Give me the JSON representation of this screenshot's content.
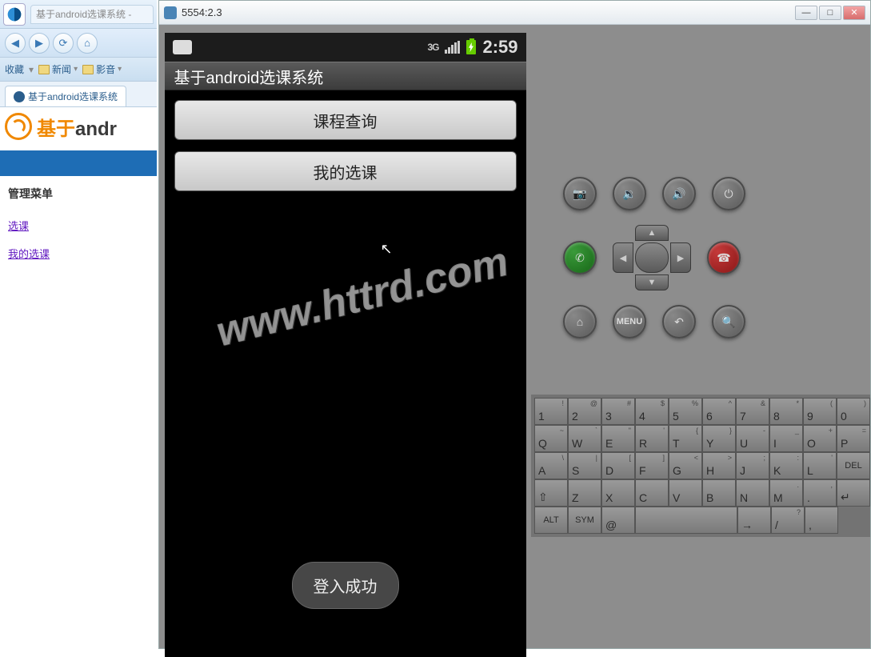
{
  "browser": {
    "inactive_tab": "基于android选课系统 -",
    "bookmarks_label": "收藏",
    "bookmarks": [
      "新闻",
      "影音"
    ],
    "page_tab": "基于android选课系统",
    "logo_plain": "基于",
    "logo_rest": "andr",
    "menu_title": "管理菜单",
    "menu_links": [
      "选课",
      "我的选课"
    ]
  },
  "emulator": {
    "title": "5554:2.3",
    "status_time": "2:59",
    "status_net": "3G",
    "app_title": "基于android选课系统",
    "buttons": [
      "课程查询",
      "我的选课"
    ],
    "toast": "登入成功",
    "watermark": "www.httrd.com",
    "hw_menu_label": "MENU"
  },
  "keyboard": {
    "row1": [
      {
        "main": "1",
        "sup": "!"
      },
      {
        "main": "2",
        "sup": "@"
      },
      {
        "main": "3",
        "sup": "#"
      },
      {
        "main": "4",
        "sup": "$"
      },
      {
        "main": "5",
        "sup": "%"
      },
      {
        "main": "6",
        "sup": "^"
      },
      {
        "main": "7",
        "sup": "&"
      },
      {
        "main": "8",
        "sup": "*"
      },
      {
        "main": "9",
        "sup": "("
      },
      {
        "main": "0",
        "sup": ")"
      }
    ],
    "row2": [
      {
        "main": "Q",
        "sup": "~"
      },
      {
        "main": "W",
        "sup": "`"
      },
      {
        "main": "E",
        "sup": "\""
      },
      {
        "main": "R",
        "sup": "'"
      },
      {
        "main": "T",
        "sup": "{"
      },
      {
        "main": "Y",
        "sup": "}"
      },
      {
        "main": "U",
        "sup": "-"
      },
      {
        "main": "I",
        "sup": "_"
      },
      {
        "main": "O",
        "sup": "+"
      },
      {
        "main": "P",
        "sup": "="
      }
    ],
    "row3": [
      {
        "main": "A",
        "sup": "\\"
      },
      {
        "main": "S",
        "sup": "|"
      },
      {
        "main": "D",
        "sup": "["
      },
      {
        "main": "F",
        "sup": "]"
      },
      {
        "main": "G",
        "sup": "<"
      },
      {
        "main": "H",
        "sup": ">"
      },
      {
        "main": "J",
        "sup": ";"
      },
      {
        "main": "K",
        "sup": ":"
      },
      {
        "main": "L",
        "sup": "'"
      },
      {
        "main": "DEL",
        "sup": ""
      }
    ],
    "row4": [
      {
        "main": "⇧",
        "sup": ""
      },
      {
        "main": "Z",
        "sup": ""
      },
      {
        "main": "X",
        "sup": ""
      },
      {
        "main": "C",
        "sup": ""
      },
      {
        "main": "V",
        "sup": ""
      },
      {
        "main": "B",
        "sup": ""
      },
      {
        "main": "N",
        "sup": ""
      },
      {
        "main": "M",
        "sup": "."
      },
      {
        "main": ".",
        "sup": ","
      },
      {
        "main": "↵",
        "sup": ""
      }
    ],
    "row5": [
      {
        "main": "ALT"
      },
      {
        "main": "SYM"
      },
      {
        "main": "@"
      },
      {
        "main": " ",
        "space": true
      },
      {
        "main": "→"
      },
      {
        "main": "/",
        "sup": "?"
      },
      {
        "main": ",",
        "sup": ""
      }
    ]
  }
}
